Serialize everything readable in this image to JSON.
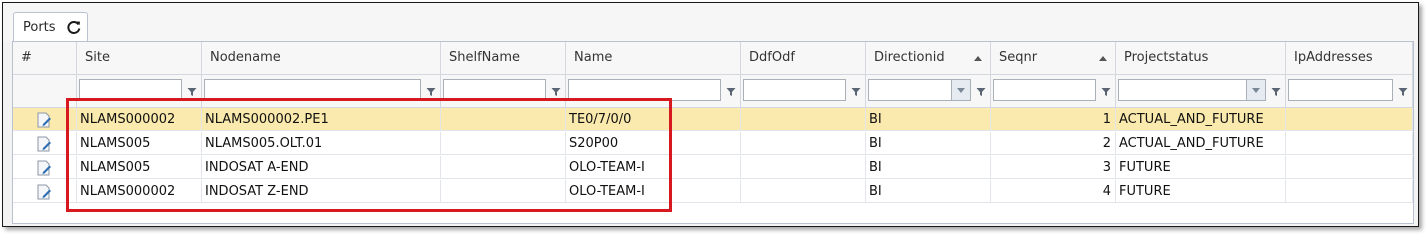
{
  "tab": {
    "label": "Ports",
    "refresh_icon": "refresh-icon"
  },
  "columns": [
    "#",
    "Site",
    "Nodename",
    "ShelfName",
    "Name",
    "DdfOdf",
    "Directionid",
    "Seqnr",
    "Projectstatus",
    "IpAddresses"
  ],
  "rows": [
    {
      "site": "NLAMS000002",
      "nodename": "NLAMS000002.PE1",
      "shelfname": "",
      "name": "TE0/7/0/0",
      "ddfodf": "",
      "directionid": "BI",
      "seqnr": "1",
      "projectstatus": "ACTUAL_AND_FUTURE",
      "ipaddresses": ""
    },
    {
      "site": "NLAMS005",
      "nodename": "NLAMS005.OLT.01",
      "shelfname": "",
      "name": "S20P00",
      "ddfodf": "",
      "directionid": "BI",
      "seqnr": "2",
      "projectstatus": "ACTUAL_AND_FUTURE",
      "ipaddresses": ""
    },
    {
      "site": "NLAMS005",
      "nodename": "INDOSAT A-END",
      "shelfname": "",
      "name": "OLO-TEAM-I",
      "ddfodf": "",
      "directionid": "BI",
      "seqnr": "3",
      "projectstatus": "FUTURE",
      "ipaddresses": ""
    },
    {
      "site": "NLAMS000002",
      "nodename": "INDOSAT Z-END",
      "shelfname": "",
      "name": "OLO-TEAM-I",
      "ddfodf": "",
      "directionid": "BI",
      "seqnr": "4",
      "projectstatus": "FUTURE",
      "ipaddresses": ""
    }
  ],
  "colors": {
    "selected_row": "#fbeaad",
    "highlight_box": "#d7191f",
    "header_bg": "#f7f7f8"
  }
}
